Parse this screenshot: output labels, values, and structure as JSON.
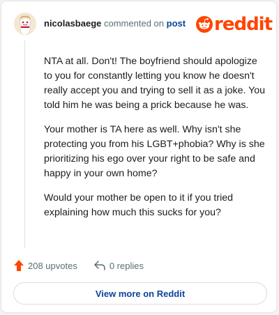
{
  "header": {
    "username": "nicolasbaege",
    "action_text": "commented on",
    "post_link": "post"
  },
  "brand": {
    "logo_text": "reddit",
    "accent_color": "#ff4500"
  },
  "comment": {
    "paragraphs": [
      "NTA at all. Don't! The boyfriend should apologize to you for constantly letting you know he doesn't really accept you and trying to sell it as a joke. You told him he was being a prick because he was.",
      "Your mother is TA here as well. Why isn't she protecting you from his LGBT+phobia? Why is she prioritizing his ego over your right to be safe and happy in your own home?",
      "Would your mother be open to it if you tried explaining how much this sucks for you?"
    ]
  },
  "actions": {
    "upvotes": "208 upvotes",
    "replies": "0 replies",
    "upvote_icon": "upvote-arrow-icon",
    "reply_icon": "reply-arrow-icon"
  },
  "footer": {
    "view_more_label": "View more on Reddit"
  }
}
